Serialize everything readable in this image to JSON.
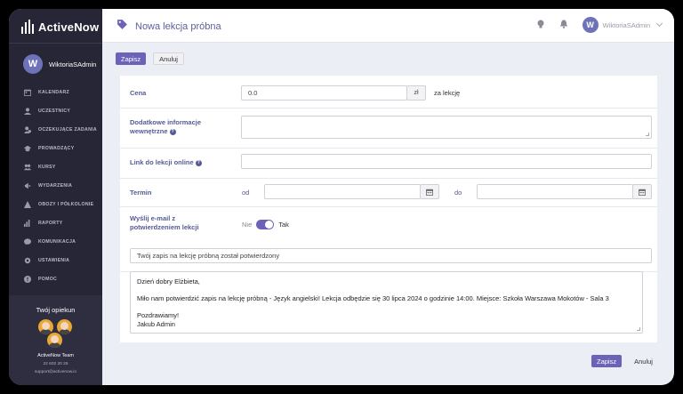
{
  "app": {
    "name": "ActiveNow"
  },
  "user": {
    "name": "WiktoriaSAdmin",
    "initial": "W"
  },
  "sidebar": {
    "items": [
      {
        "label": "KALENDARZ",
        "icon": "calendar-icon"
      },
      {
        "label": "UCZESTNICY",
        "icon": "user-icon"
      },
      {
        "label": "OCZEKUJĄCE ZADANIA",
        "icon": "user-clock-icon"
      },
      {
        "label": "PROWADZĄCY",
        "icon": "graduation-cap-icon"
      },
      {
        "label": "KURSY",
        "icon": "users-icon"
      },
      {
        "label": "WYDARZENIA",
        "icon": "megaphone-icon"
      },
      {
        "label": "OBOZY I PÓŁKOLONIE",
        "icon": "tent-icon"
      },
      {
        "label": "RAPORTY",
        "icon": "bar-chart-icon"
      },
      {
        "label": "KOMUNIKACJA",
        "icon": "chat-icon"
      },
      {
        "label": "USTAWIENIA",
        "icon": "gear-icon"
      },
      {
        "label": "POMOC",
        "icon": "help-circle-icon"
      }
    ],
    "guardian": {
      "title": "Twój opiekun",
      "team": "ActiveNow Team",
      "phone": "22 602 20 25",
      "email": "support@activenow.io"
    }
  },
  "header": {
    "title": "Nowa lekcja próbna"
  },
  "toolbar": {
    "save_label": "Zapisz",
    "cancel_label": "Anuluj"
  },
  "form": {
    "price": {
      "label": "Cena",
      "value": "0.0",
      "currency": "zł",
      "suffix": "za lekcję"
    },
    "internal_info": {
      "label_line1": "Dodatkowe informacje",
      "label_line2": "wewnętrzne",
      "value": ""
    },
    "online_link": {
      "label": "Link do lekcji online",
      "value": ""
    },
    "term": {
      "label": "Termin",
      "from_label": "od",
      "to_label": "do",
      "from_value": "",
      "to_value": ""
    },
    "send_email": {
      "label_line1": "Wyślij e-mail z",
      "label_line2": "potwierdzeniem lekcji",
      "off_label": "Nie",
      "on_label": "Tak",
      "enabled": true
    },
    "email_subject": "Twój zapis na lekcję próbną został potwierdzony",
    "email_body": {
      "greeting": "Dzień dobry Elżbieta,",
      "message": "Miło nam potwierdzić zapis na lekcję próbną - Język angielski! Lekcja odbędzie się 30 lipca 2024 o godzinie 14:00. Miejsce: Szkoła Warszawa Mokotów - Sala 3",
      "closing": "Pozdrawiamy!",
      "signature": "Jakub Admin"
    }
  },
  "footer": {
    "save_label": "Zapisz",
    "cancel_label": "Anuluj"
  },
  "colors": {
    "accent": "#6c63b8",
    "sidebar": "#262636",
    "label": "#555a96"
  }
}
